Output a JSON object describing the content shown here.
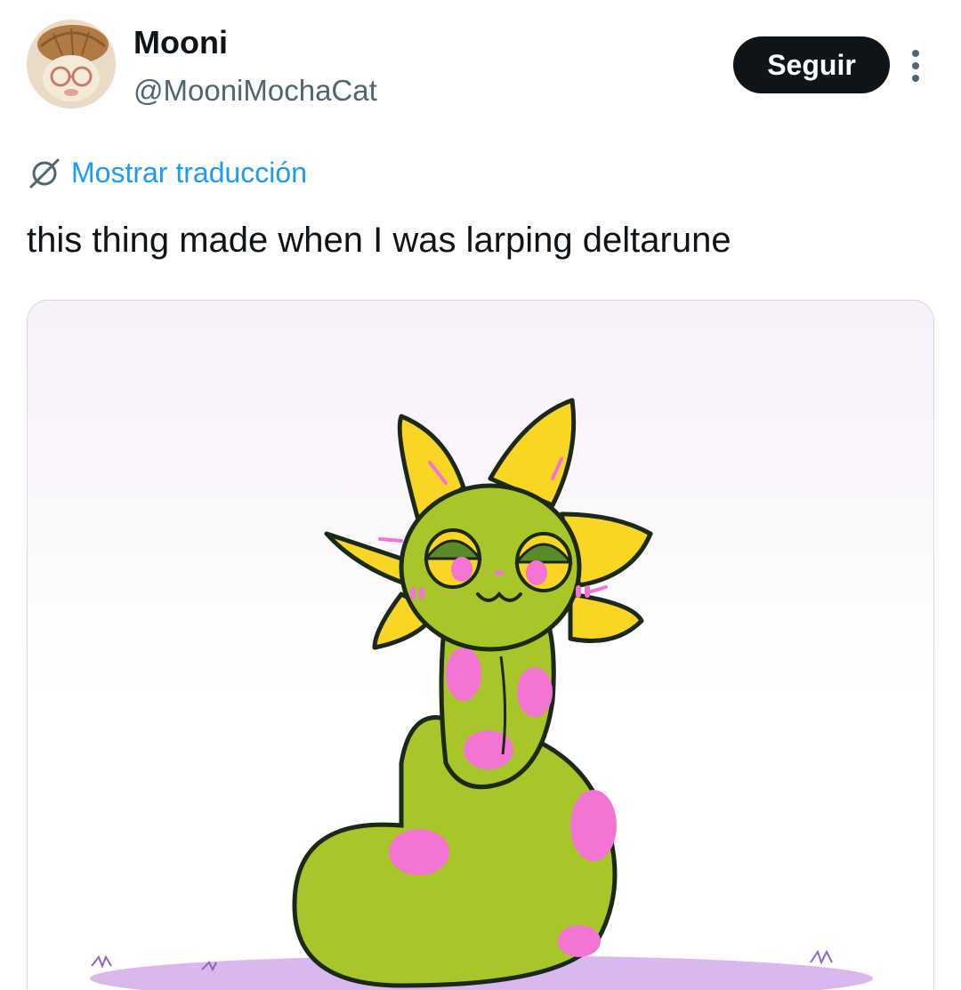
{
  "author": {
    "display_name": "Mooni",
    "handle": "@MooniMochaCat"
  },
  "actions": {
    "follow_label": "Seguir",
    "more_icon": "more-vertical-icon"
  },
  "translate": {
    "label": "Mostrar traducción",
    "icon": "translate-icon"
  },
  "tweet": {
    "text": "this thing made when I was larping deltarune"
  },
  "media": {
    "description_icon": "illustration",
    "colors": {
      "body": "#a8c62a",
      "spots": "#f474d4",
      "petals": "#f9d524",
      "outline": "#1b2a14",
      "ground": "#d9b8ee"
    }
  },
  "colors": {
    "accent": "#1d9bf0",
    "button_bg": "#0f1419",
    "secondary_text": "#536471"
  }
}
